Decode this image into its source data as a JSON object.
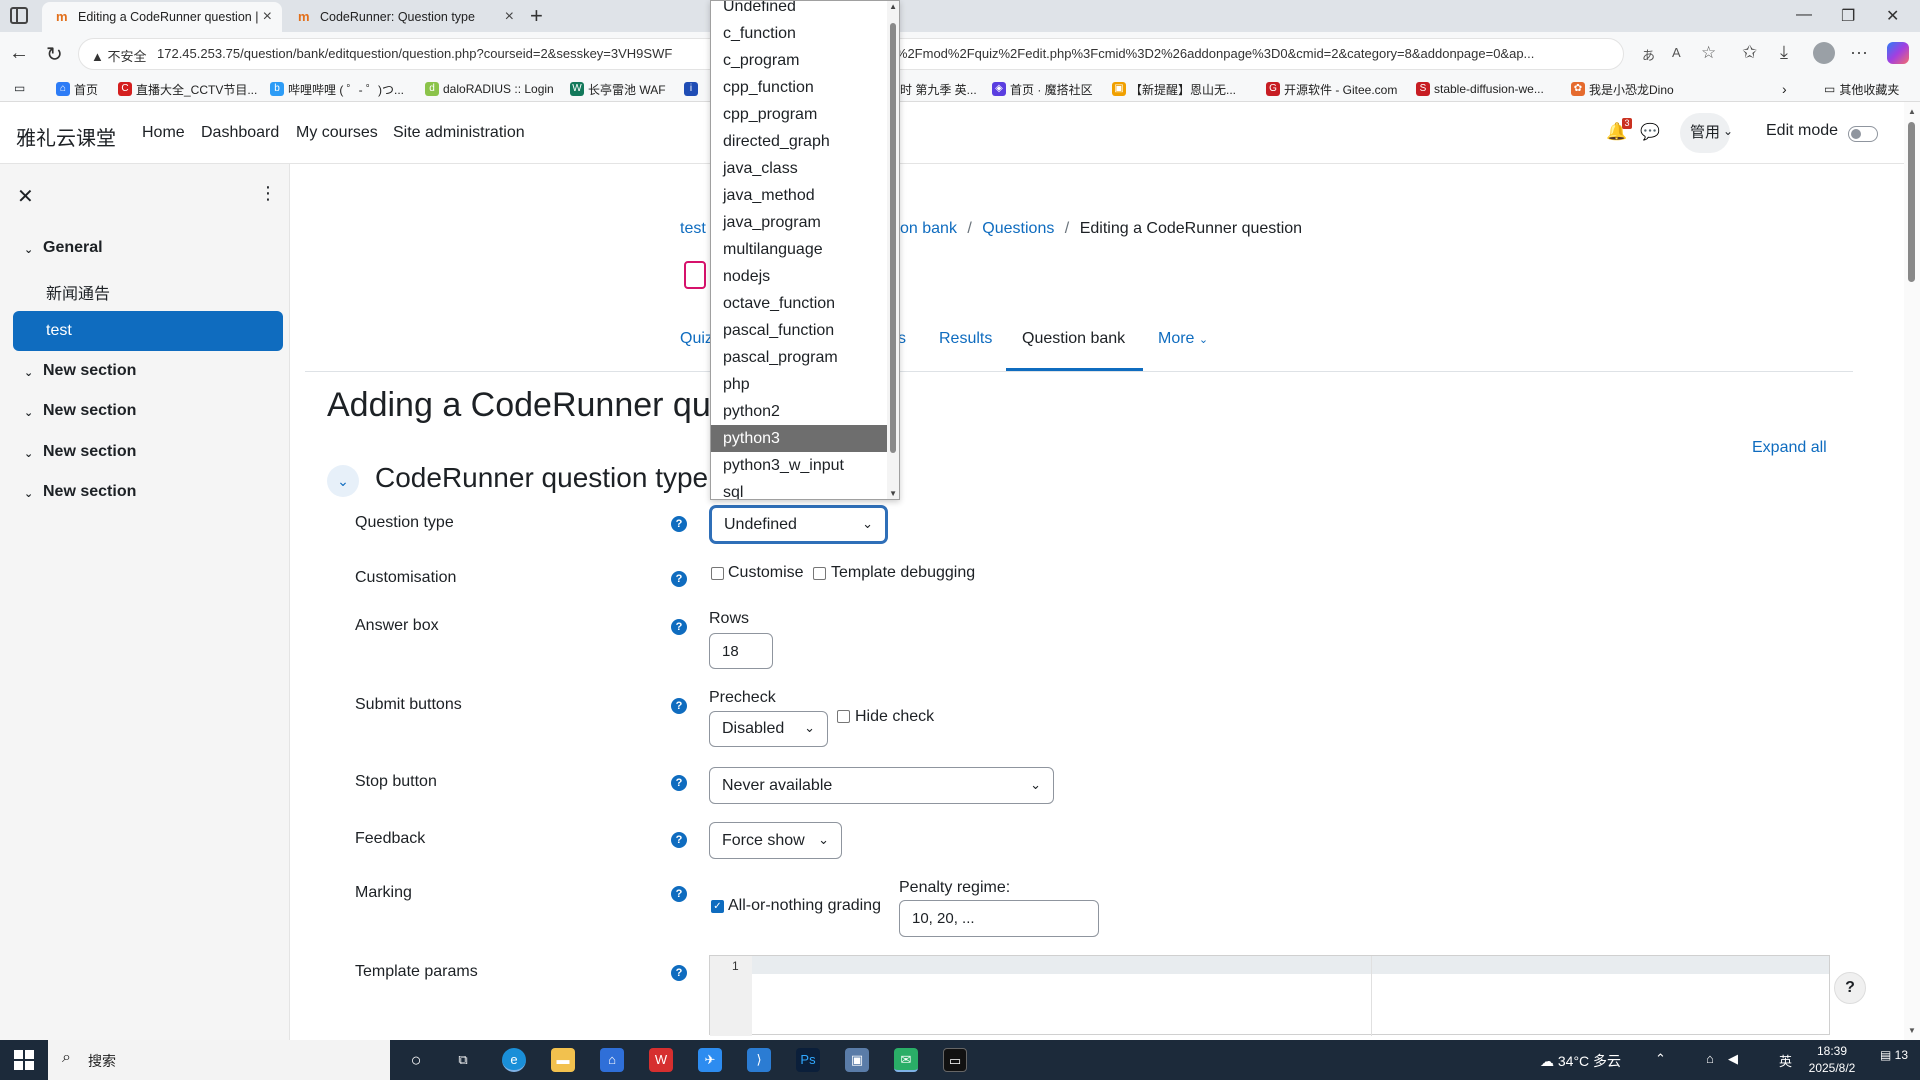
{
  "browser": {
    "tabs": [
      {
        "title": "Editing a CodeRunner question |",
        "active": true
      },
      {
        "title": "CodeRunner: Question type",
        "active": false
      }
    ],
    "security_label": "不安全",
    "url_start": "172.45.253.75/question/bank/editquestion/question.php?courseid=2&sesskey=3VH9SWF",
    "url_end": "rnurl=%2Fmod%2Fquiz%2Fedit.php%3Fcmid%3D2%26addonpage%3D0&cmid=2&category=8&addonpage=0&ap...",
    "bookmarks": [
      "首页",
      "直播大全_CCTV节目...",
      "哔哩哔哩 ( ゜- ゜)つ...",
      "daloRADIUS :: Login",
      "长亭雷池 WAF",
      "i",
      "时 第九季 英...",
      "首页 · 魔搭社区",
      "【新提醒】恩山无...",
      "开源软件 - Gitee.com",
      "stable-diffusion-we...",
      "我是小恐龙Dino"
    ],
    "other_bookmarks": "其他收藏夹"
  },
  "navbar": {
    "brand": "雅礼云课堂",
    "links": [
      "Home",
      "Dashboard",
      "My courses",
      "Site administration"
    ],
    "notification_count": "3",
    "user": "管用",
    "edit_mode": "Edit mode"
  },
  "drawer": {
    "items": [
      {
        "label": "General",
        "type": "section"
      },
      {
        "label": "新闻通告",
        "type": "sub"
      },
      {
        "label": "test",
        "type": "active"
      },
      {
        "label": "New section",
        "type": "section"
      },
      {
        "label": "New section",
        "type": "section"
      },
      {
        "label": "New section",
        "type": "section"
      },
      {
        "label": "New section",
        "type": "section"
      }
    ]
  },
  "breadcrumb": {
    "first": "test",
    "middle": "on bank",
    "sep": "/",
    "questions": "Questions",
    "current": "Editing a CodeRunner question"
  },
  "sectabs": [
    "Quiz",
    "s",
    "Results",
    "Question bank",
    "More"
  ],
  "page": {
    "title": "Adding a CodeRunner question",
    "expand_all": "Expand all",
    "section_title": "CodeRunner question type"
  },
  "form": {
    "question_type": {
      "label": "Question type",
      "value": "Undefined"
    },
    "customisation": {
      "label": "Customisation",
      "customise": "Customise",
      "template_debugging": "Template debugging"
    },
    "answer_box": {
      "label": "Answer box",
      "rows_label": "Rows",
      "rows_value": "18"
    },
    "submit_buttons": {
      "label": "Submit buttons",
      "precheck_label": "Precheck",
      "precheck_value": "Disabled",
      "hide_check": "Hide check"
    },
    "stop_button": {
      "label": "Stop button",
      "value": "Never available"
    },
    "feedback": {
      "label": "Feedback",
      "value": "Force show"
    },
    "marking": {
      "label": "Marking",
      "all_or_nothing": "All-or-nothing grading",
      "penalty_label": "Penalty regime:",
      "penalty_value": "10, 20, ..."
    },
    "template_params": {
      "label": "Template params",
      "line_number": "1"
    }
  },
  "dropdown": {
    "options": [
      "Undefined",
      "c_function",
      "c_program",
      "cpp_function",
      "cpp_program",
      "directed_graph",
      "java_class",
      "java_method",
      "java_program",
      "multilanguage",
      "nodejs",
      "octave_function",
      "pascal_function",
      "pascal_program",
      "php",
      "python2",
      "python3",
      "python3_w_input",
      "sql"
    ],
    "highlighted": "python3"
  },
  "taskbar": {
    "search": "搜索",
    "weather": "34°C 多云",
    "ime": "英",
    "time": "18:39",
    "date": "2025/8/2",
    "notifications": "13"
  },
  "colors": {
    "primary": "#0f6cbf",
    "drawer_bg": "#f5f5f5",
    "taskbar": "#1c2a3a",
    "highlight": "#6e6e6e"
  }
}
